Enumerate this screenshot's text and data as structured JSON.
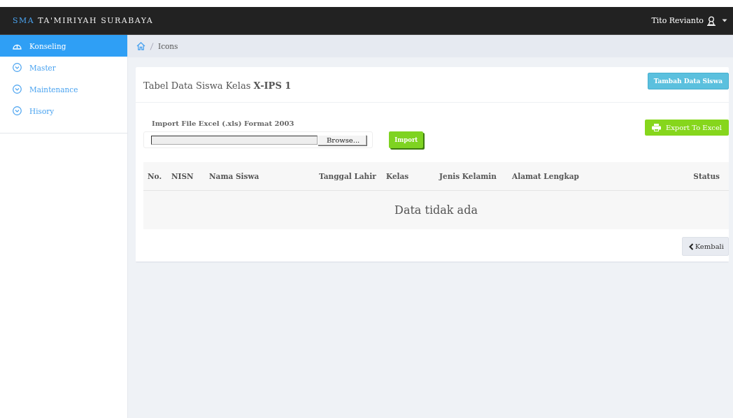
{
  "header": {
    "brand_prefix": "SMA",
    "brand_name": "TA'MIRIYAH SURABAYA",
    "user": "Tito Revianto"
  },
  "sidebar": {
    "items": [
      {
        "label": "Konseling",
        "kind": "dashboard",
        "selected": true
      },
      {
        "label": "Master",
        "kind": "dropdown",
        "selected": false
      },
      {
        "label": "Maintenance",
        "kind": "dropdown",
        "selected": false
      },
      {
        "label": "Hisory",
        "kind": "dropdown",
        "selected": false
      }
    ]
  },
  "breadcrumb": {
    "current": "Icons"
  },
  "panel": {
    "title": "Tabel Data Siswa Kelas **X-IPS 1**",
    "add_button": "Tambah Data Siswa",
    "import_label": "Import File Excel (.xls) Format 2003",
    "browse_button": "Browse...",
    "import_button": "Import",
    "export_button": "Export To Excel",
    "table": {
      "columns": [
        "No.",
        "NISN",
        "Nama Siswa",
        "Tanggal Lahir",
        "Kelas",
        "Jenis Kelamin",
        "Alamat Lengkap",
        "Status"
      ],
      "empty_message": "Data tidak ada"
    },
    "back_button": "Kembali"
  }
}
